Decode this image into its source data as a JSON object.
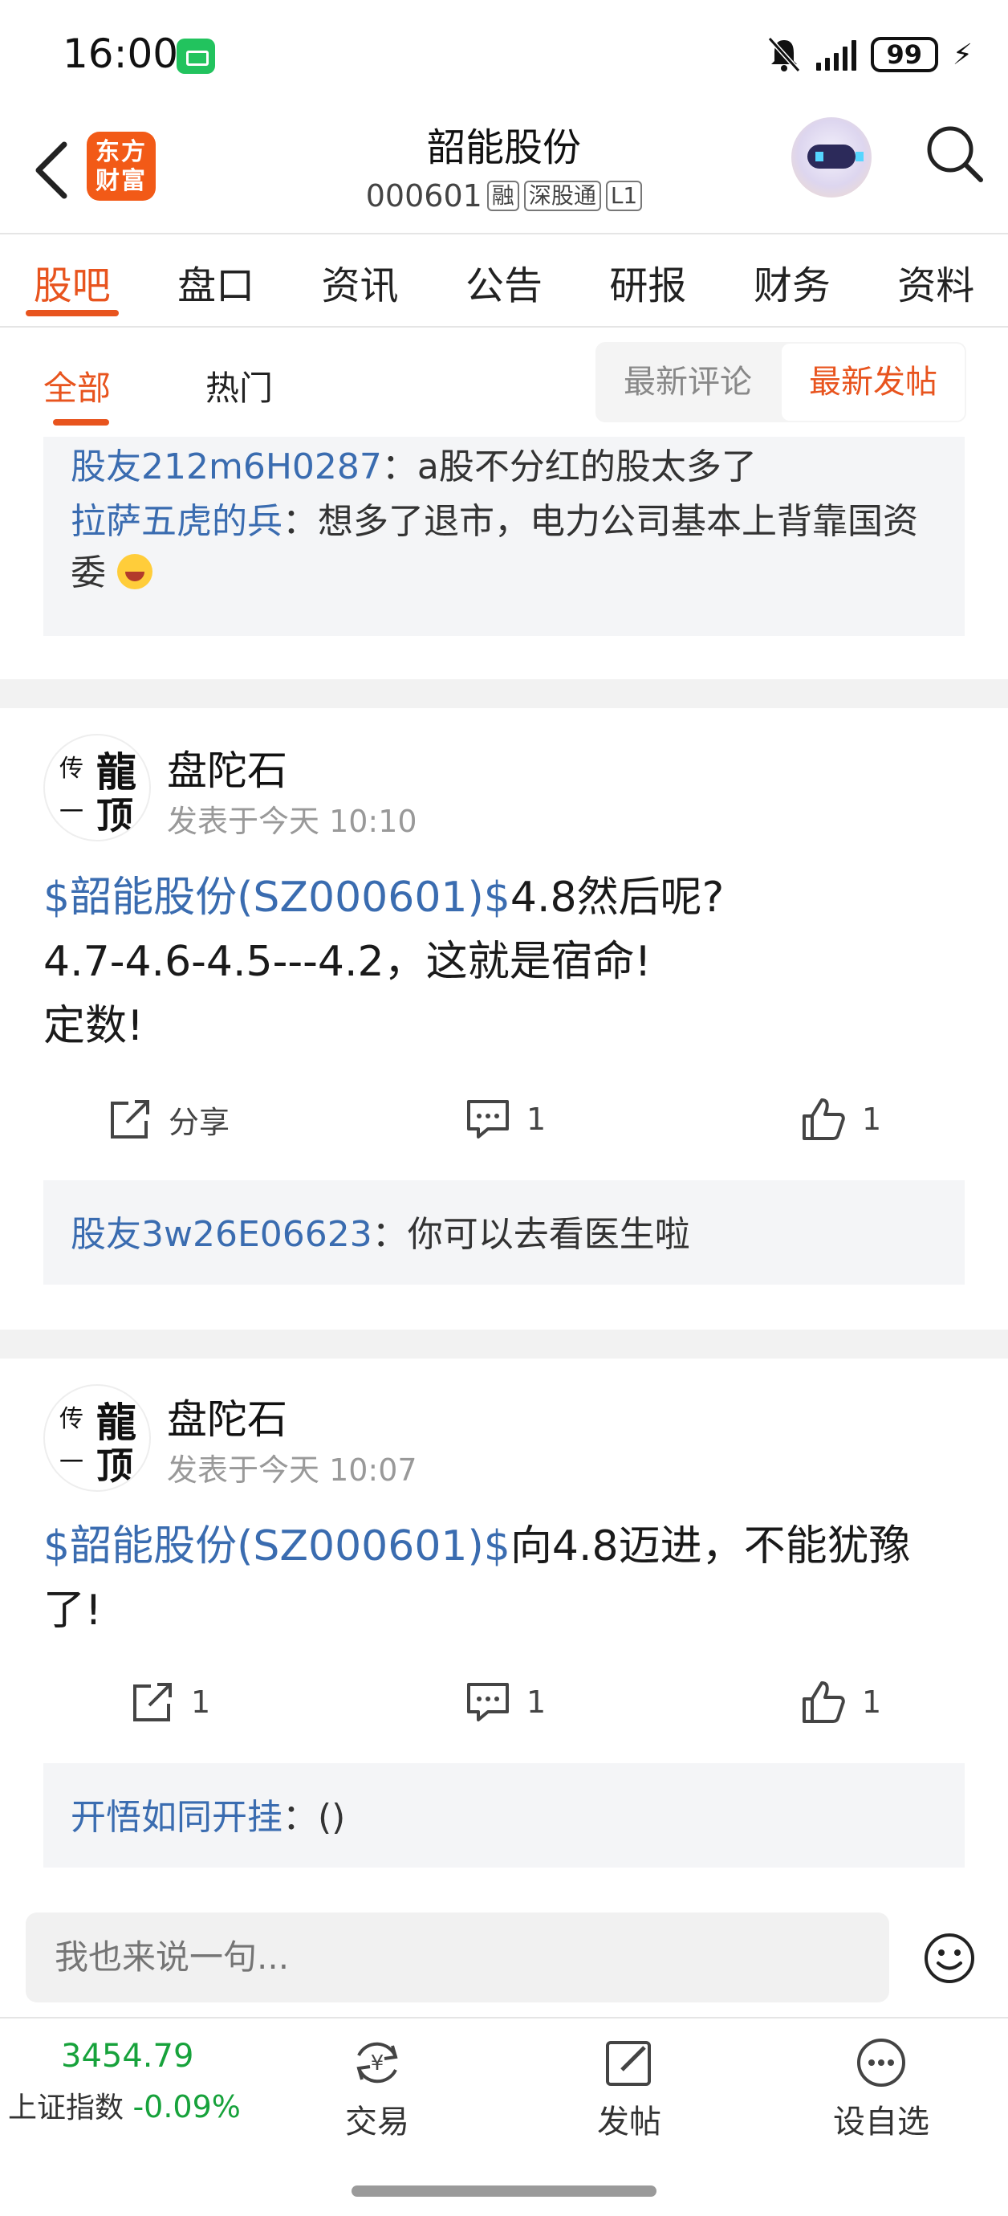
{
  "status": {
    "time": "16:00",
    "battery": "99"
  },
  "header": {
    "logo_line1": "东方",
    "logo_line2": "财富",
    "stock_name": "韶能股份",
    "stock_code": "000601",
    "tags": [
      "融",
      "深股通",
      "L1"
    ]
  },
  "main_tabs": [
    "股吧",
    "盘口",
    "资讯",
    "公告",
    "研报",
    "财务",
    "资料"
  ],
  "sub_tabs": {
    "all": "全部",
    "hot": "热门",
    "latest_comment": "最新评论",
    "latest_post": "最新发帖"
  },
  "top_comments": [
    {
      "user": "股友212m6H0287",
      "text": "：a股不分红的股太多了"
    },
    {
      "user": "拉萨五虎的兵",
      "text": "：想多了退市，电力公司基本上背靠国资委"
    }
  ],
  "posts": [
    {
      "author": "盘陀石",
      "time": "发表于今天 10:10",
      "stock_link": "$韶能股份(SZ000601)$",
      "text": "4.8然后呢?",
      "text2": "4.7-4.6-4.5---4.2，这就是宿命!",
      "text3": "定数!",
      "share_label": "分享",
      "comments": "1",
      "likes": "1",
      "reply_user": "股友3w26E06623",
      "reply_text": "：你可以去看医生啦"
    },
    {
      "author": "盘陀石",
      "time": "发表于今天 10:07",
      "stock_link": "$韶能股份(SZ000601)$",
      "text": "向4.8迈进，不能犹豫",
      "text2": "了!",
      "shares": "1",
      "comments": "1",
      "likes": "1",
      "reply_user": "开悟如同开挂",
      "reply_text": "：()"
    }
  ],
  "avatar_text": {
    "a": "传",
    "b": "龍",
    "c": "一",
    "d": "顶"
  },
  "input": {
    "placeholder": "我也来说一句..."
  },
  "bottom": {
    "index_value": "3454.79",
    "index_label": "上证指数",
    "index_change": "-0.09%",
    "trade": "交易",
    "post": "发帖",
    "watchlist": "设自选"
  },
  "colors": {
    "accent": "#e8541e",
    "link": "#3a6cb0",
    "down": "#17a23b"
  }
}
